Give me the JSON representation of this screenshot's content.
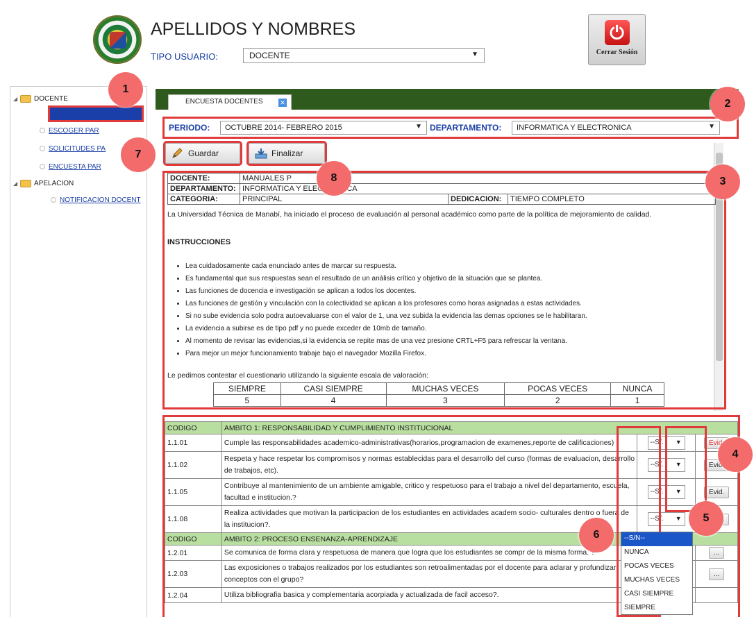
{
  "header": {
    "user_title": "APELLIDOS Y NOMBRES",
    "tipo_usuario_label": "TIPO USUARIO:",
    "tipo_usuario_value": "DOCENTE",
    "logout_label": "Cerrar Sesión"
  },
  "sidebar": {
    "groups": [
      {
        "label": "DOCENTE",
        "items": [
          "ESCOGER PAR",
          "SOLICITUDES PA",
          "ENCUESTA PAR"
        ]
      },
      {
        "label": "APELACION",
        "items": [
          "NOTIFICACION DOCENT"
        ]
      }
    ]
  },
  "tab": {
    "label": "ENCUESTA DOCENTES"
  },
  "filters": {
    "periodo_label": "PERIODO:",
    "periodo_value": "OCTUBRE 2014- FEBRERO 2015",
    "departamento_label": "DEPARTAMENTO:",
    "departamento_value": "INFORMATICA Y ELECTRONICA"
  },
  "toolbar": {
    "save_label": "Guardar",
    "finish_label": "Finalizar"
  },
  "info": {
    "docente_key": "DOCENTE:",
    "docente_value": "MANUALES P",
    "departamento_key": "DEPARTAMENTO:",
    "departamento_value": "INFORMATICA Y ELECTRONICA",
    "categoria_key": "CATEGORIA:",
    "categoria_value": "PRINCIPAL",
    "dedicacion_key": "DEDICACION:",
    "dedicacion_value": "TIEMPO COMPLETO"
  },
  "intro_text": "La Universidad Técnica de Manabí, ha iniciado el proceso de evaluación al personal académico como parte de la política de mejoramiento de calidad.",
  "instructions_title": "INSTRUCCIONES",
  "instructions": [
    "Lea cuidadosamente cada enunciado antes de marcar su respuesta.",
    "Es fundamental que sus respuestas sean el resultado de un análisis crítico y objetivo de la situación que se plantea.",
    "Las funciones de docencia e investigación se aplican a todos los docentes.",
    "Las funciones de gestión y vinculación con la colectividad se aplican a los profesores como horas asignadas a estas actividades.",
    "Si no sube evidencia solo podra autoevaluarse con el valor de 1, una vez subida la evidencia las demas opciones se le habilitaran.",
    "La evidencia a subirse es de tipo pdf y no puede exceder de 10mb de tamaño.",
    "Al momento de revisar las evidencias,si la evidencia se repite mas de una vez presione CRTL+F5 para refrescar la ventana.",
    "Para mejor un mejor funcionamiento trabaje bajo el navegador Mozilla Firefox."
  ],
  "scale_intro": "Le pedimos contestar el cuestionario utilizando la siguiente escala de valoración:",
  "scale": {
    "labels": [
      "SIEMPRE",
      "CASI SIEMPRE",
      "MUCHAS VECES",
      "POCAS VECES",
      "NUNCA"
    ],
    "values": [
      "5",
      "4",
      "3",
      "2",
      "1"
    ]
  },
  "questions": {
    "section1": {
      "code_header": "CODIGO",
      "title": "AMBITO 1: RESPONSABILIDAD Y CUMPLIMIENTO INSTITUCIONAL"
    },
    "rows1": [
      {
        "code": "1.1.01",
        "text": "Cumple las responsabilidades academico-administrativas(horarios,programacion de examenes,reporte de calificaciones)"
      },
      {
        "code": "1.1.02",
        "text": "Respeta y hace respetar los compromisos y normas establecidas para el desarrollo del curso (formas de evaluacion, desarrollo de trabajos, etc)."
      },
      {
        "code": "1.1.05",
        "text": "Contribuye al mantenimiento de un ambiente amigable, critico y respetuoso para el trabajo a nivel del departamento, escuela, facultad e institucion.?"
      },
      {
        "code": "1.1.08",
        "text": "Realiza actividades que motivan la participacion de los estudiantes en actividades academ socio- culturales dentro o fuera de la institucion?."
      }
    ],
    "section2": {
      "code_header": "CODIGO",
      "title": "AMBITO 2: PROCESO ENSENANZA-APRENDIZAJE"
    },
    "rows2": [
      {
        "code": "1.2.01",
        "text": "Se comunica de forma clara y respetuosa de manera que logra que los estudiantes se compr de la misma forma. ?"
      },
      {
        "code": "1.2.03",
        "text": "Las exposiciones o trabajos realizados por los estudiantes son retroalimentadas por el docente para aclarar y profundizar conceptos con el grupo?"
      },
      {
        "code": "1.2.04",
        "text": "Utiliza bibliografia basica y complementaria acorpiada y actualizada de facil acceso?."
      }
    ],
    "select_value": "--S/.",
    "evid_label": "Evid."
  },
  "dropdown_options": [
    "--S/N--",
    "NUNCA",
    "POCAS VECES",
    "MUCHAS VECES",
    "CASI SIEMPRE",
    "SIEMPRE"
  ],
  "badges": [
    "1",
    "2",
    "3",
    "4",
    "5",
    "6",
    "7",
    "8"
  ]
}
